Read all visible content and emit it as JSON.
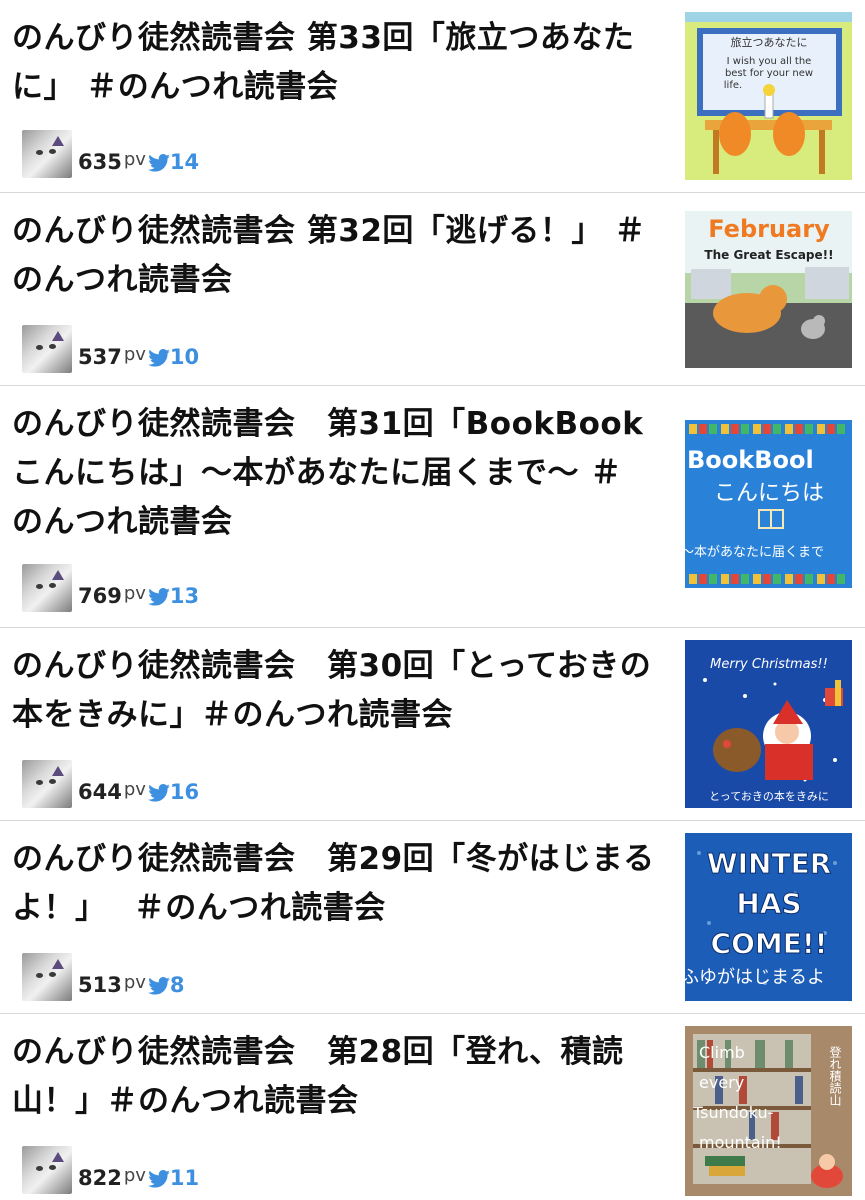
{
  "articles": [
    {
      "title": "のんびり徒然読書会 第33回「旅立つあなたに」 ＃のんつれ読書会",
      "pv": "635",
      "pv_unit": "pv",
      "tweets": "14",
      "thumb_lines": [
        "旅立つあなたに",
        "I wish you all the",
        "best for your new",
        "life."
      ]
    },
    {
      "title": "のんびり徒然読書会 第32回「逃げる！」 ＃のんつれ読書会",
      "pv": "537",
      "pv_unit": "pv",
      "tweets": "10",
      "thumb_lines": [
        "February",
        "The Great Escape!!"
      ]
    },
    {
      "title": "のんびり徒然読書会　第31回「BookBookこんにちは」〜本があなたに届くまで〜 ＃のんつれ読書会",
      "pv": "769",
      "pv_unit": "pv",
      "tweets": "13",
      "thumb_lines": [
        "BookBool",
        "こんにちは",
        "〜本があなたに届くまで"
      ]
    },
    {
      "title": "のんびり徒然読書会　第30回「とっておきの本をきみに」＃のんつれ読書会",
      "pv": "644",
      "pv_unit": "pv",
      "tweets": "16",
      "thumb_lines": [
        "Merry Christmas!!",
        "とっておきの本をきみに"
      ]
    },
    {
      "title": "のんびり徒然読書会　第29回「冬がはじまるよ！」　 ＃のんつれ読書会",
      "pv": "513",
      "pv_unit": "pv",
      "tweets": "8",
      "thumb_lines": [
        "WINTER",
        "HAS",
        "COME!!",
        "ふゆがはじまるよ"
      ]
    },
    {
      "title": "のんびり徒然読書会　第28回「登れ、積読山！」＃のんつれ読書会",
      "pv": "822",
      "pv_unit": "pv",
      "tweets": "11",
      "thumb_lines": [
        "Climb",
        "every",
        "Tsundoku-",
        "mountain!",
        "登れ積読山"
      ]
    }
  ],
  "colors": {
    "tweet_blue": "#3d8fe0",
    "divider": "#d8d8d8"
  },
  "icons": {
    "author": "cat-avatar",
    "tweet": "twitter-bird-icon"
  }
}
